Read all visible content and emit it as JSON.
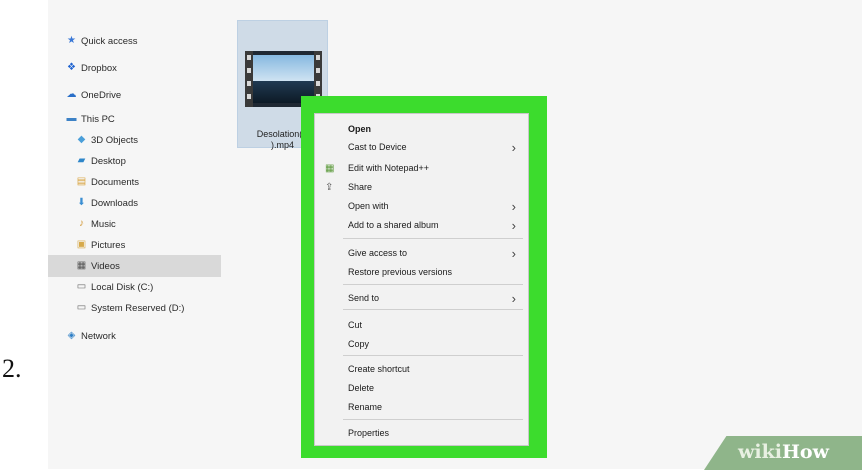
{
  "step_number": "2.",
  "nav": {
    "items": [
      {
        "label": "Quick access",
        "icon": "star-icon",
        "selected": false
      },
      {
        "label": "Dropbox",
        "icon": "dropbox-icon",
        "selected": false
      },
      {
        "label": "OneDrive",
        "icon": "cloud-icon",
        "selected": false
      },
      {
        "label": "This PC",
        "icon": "computer-icon",
        "selected": false
      },
      {
        "label": "3D Objects",
        "icon": "cube-icon",
        "selected": false
      },
      {
        "label": "Desktop",
        "icon": "desktop-folder-icon",
        "selected": false
      },
      {
        "label": "Documents",
        "icon": "documents-folder-icon",
        "selected": false
      },
      {
        "label": "Downloads",
        "icon": "downloads-folder-icon",
        "selected": false
      },
      {
        "label": "Music",
        "icon": "music-folder-icon",
        "selected": false
      },
      {
        "label": "Pictures",
        "icon": "pictures-folder-icon",
        "selected": false
      },
      {
        "label": "Videos",
        "icon": "videos-folder-icon",
        "selected": true
      },
      {
        "label": "Local Disk (C:)",
        "icon": "disk-icon",
        "selected": false
      },
      {
        "label": "System Reserved (D:)",
        "icon": "disk-icon",
        "selected": false
      },
      {
        "label": "Network",
        "icon": "network-icon",
        "selected": false
      }
    ]
  },
  "file": {
    "name_line1": "Desolation(V",
    "name_line2": ").mp4"
  },
  "context_menu": {
    "items": [
      {
        "label": "Open",
        "bold": true,
        "submenu": false,
        "icon": ""
      },
      {
        "label": "Cast to Device",
        "bold": false,
        "submenu": true,
        "icon": ""
      },
      {
        "label": "Edit with Notepad++",
        "bold": false,
        "submenu": false,
        "icon": "notepad-icon"
      },
      {
        "label": "Share",
        "bold": false,
        "submenu": false,
        "icon": "share-icon"
      },
      {
        "label": "Open with",
        "bold": false,
        "submenu": true,
        "icon": ""
      },
      {
        "label": "Add to a shared album",
        "bold": false,
        "submenu": true,
        "icon": ""
      },
      {
        "label": "Give access to",
        "bold": false,
        "submenu": true,
        "icon": ""
      },
      {
        "label": "Restore previous versions",
        "bold": false,
        "submenu": false,
        "icon": ""
      },
      {
        "label": "Send to",
        "bold": false,
        "submenu": true,
        "icon": ""
      },
      {
        "label": "Cut",
        "bold": false,
        "submenu": false,
        "icon": ""
      },
      {
        "label": "Copy",
        "bold": false,
        "submenu": false,
        "icon": ""
      },
      {
        "label": "Create shortcut",
        "bold": false,
        "submenu": false,
        "icon": ""
      },
      {
        "label": "Delete",
        "bold": false,
        "submenu": false,
        "icon": ""
      },
      {
        "label": "Rename",
        "bold": false,
        "submenu": false,
        "icon": ""
      },
      {
        "label": "Properties",
        "bold": false,
        "submenu": false,
        "icon": ""
      }
    ],
    "chevron": "›"
  },
  "watermark": {
    "wiki": "wiki",
    "how": "How"
  },
  "colors": {
    "highlight": "#3cdc2d",
    "selected_row": "#d9d9d9",
    "file_tile": "#cfdbe7"
  }
}
